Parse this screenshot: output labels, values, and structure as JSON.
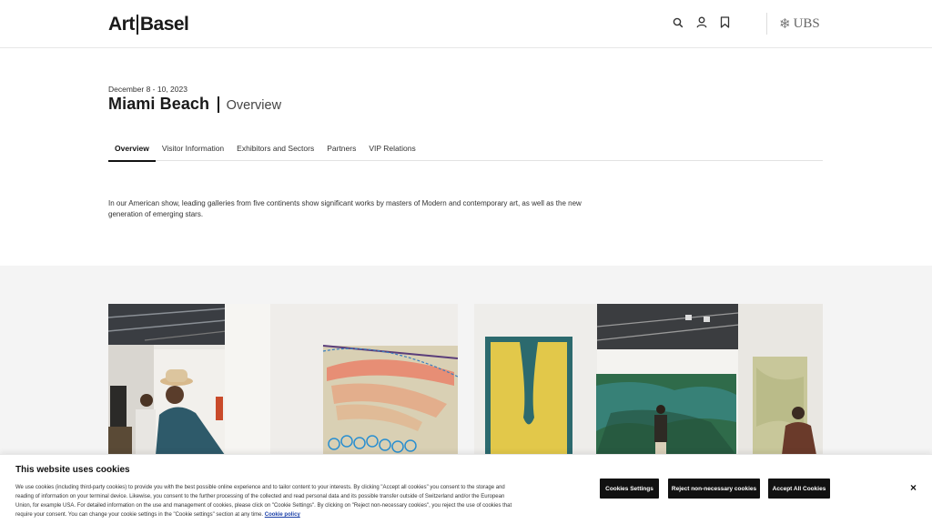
{
  "header": {
    "logo_left": "Art",
    "logo_right": "Basel",
    "icons": [
      "search-icon",
      "user-icon",
      "bookmark-icon"
    ],
    "partner": "UBS"
  },
  "event": {
    "date": "December 8 - 10, 2023",
    "title": "Miami Beach",
    "subtitle": "Overview"
  },
  "tabs": [
    {
      "label": "Overview",
      "active": true
    },
    {
      "label": "Visitor Information",
      "active": false
    },
    {
      "label": "Exhibitors and Sectors",
      "active": false
    },
    {
      "label": "Partners",
      "active": false
    },
    {
      "label": "VIP Relations",
      "active": false
    }
  ],
  "intro": "In our American show, leading galleries from five continents show significant works by masters of Modern and contemporary art, as well as the new generation of emerging stars.",
  "cookie": {
    "title": "This website uses cookies",
    "text": "We use cookies (including third-party cookies) to provide you with the best possible online experience and to tailor content to your interests. By clicking \"Accept all cookies\" you consent to the storage and reading of information on your terminal device. Likewise, you consent to the further processing of the collected and read personal data and its possible transfer outside of Switzerland and/or the European Union, for example USA. For detailed information on the use and management of cookies, please click on \"Cookie Settings\". By clicking on \"Reject non-necessary cookies\", you reject the use of cookies that require your consent. You can change your cookie settings in the \"Cookie settings\" section at any time.",
    "policy_link": "Cookie policy",
    "settings_btn": "Cookies Settings",
    "reject_btn": "Reject non-necessary cookies",
    "accept_btn": "Accept All Cookies",
    "close": "×"
  },
  "colors": {
    "accent": "#111111",
    "band": "#f4f4f4",
    "link": "#1a3fa8"
  }
}
